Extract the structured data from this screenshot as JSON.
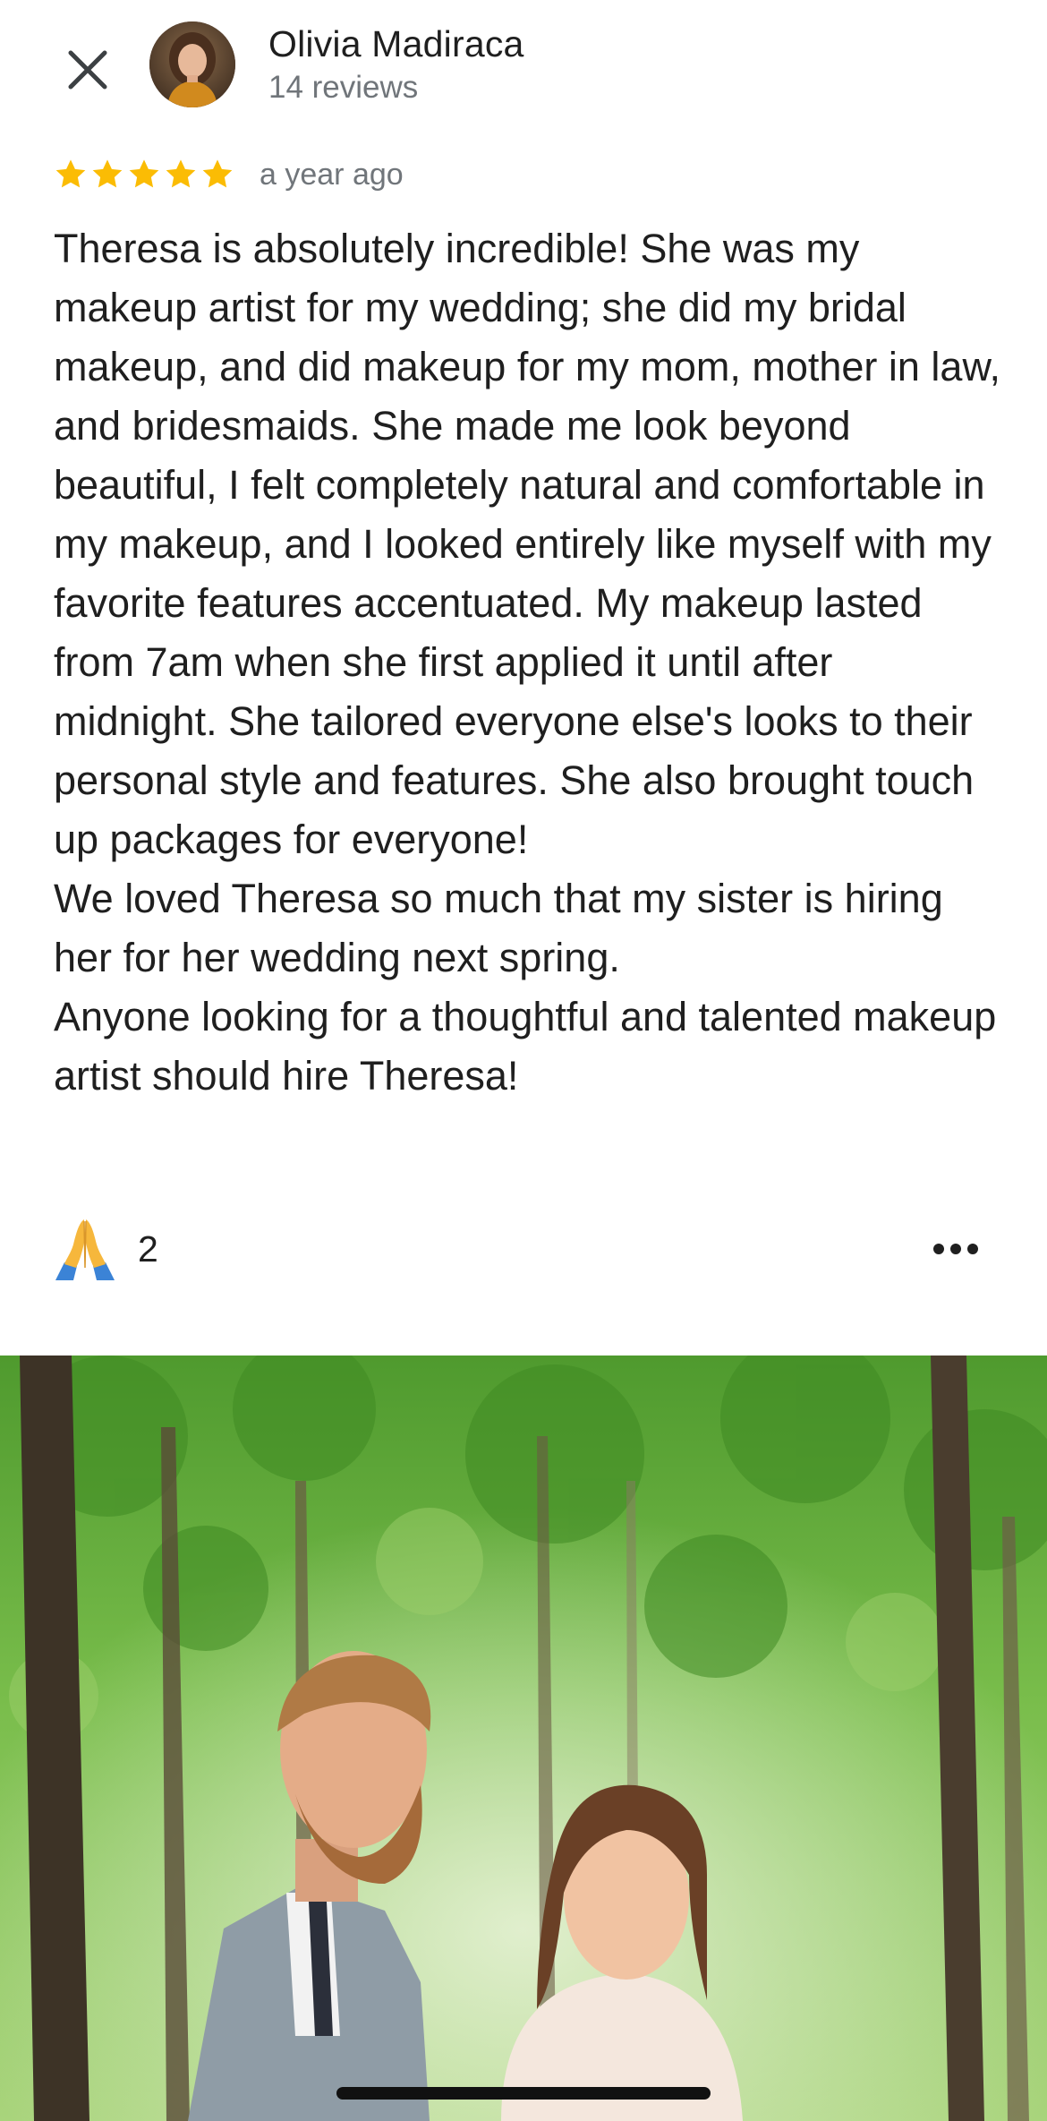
{
  "header": {
    "close_icon": "close-icon",
    "reviewer_name": "Olivia Madiraca",
    "review_count": "14 reviews"
  },
  "review": {
    "rating": 5,
    "max_rating": 5,
    "star_color": "#fbbc04",
    "timestamp": "a year ago",
    "paragraphs": [
      "Theresa is absolutely incredible! She was my makeup artist for my wedding; she did my bridal makeup, and did makeup for my mom, mother in law, and bridesmaids. She made me look beyond beautiful, I felt completely natural and comfortable in my makeup, and I looked entirely like myself with my favorite features accentuated. My makeup lasted from 7am when she first applied it until after midnight. She tailored everyone else's looks to their personal style and features. She also brought touch up packages for everyone!",
      "We loved Theresa so much that my sister is hiring her for her wedding next spring.",
      "Anyone looking for a thoughtful and talented makeup artist should hire Theresa!"
    ]
  },
  "reactions": {
    "icon": "folded-hands-icon",
    "count": "2",
    "more_icon": "more-horiz-icon"
  },
  "photo": {
    "icon": "review-photo"
  }
}
